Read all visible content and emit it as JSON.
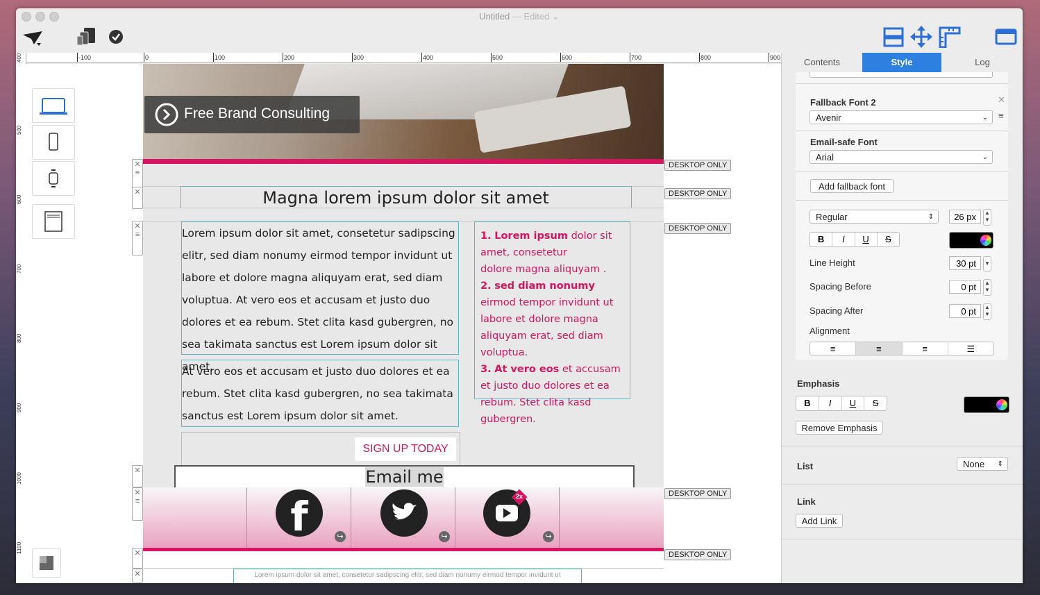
{
  "window": {
    "title": "Untitled",
    "edited": "— Edited"
  },
  "toolbar": {
    "left_icons": [
      "paper-plane-icon",
      "devices-icon",
      "checkmark-icon"
    ],
    "right_icons": [
      "layout-icon",
      "move-icon",
      "ruler-icon",
      "sidebar-icon"
    ]
  },
  "ruler": {
    "h_labels": [
      "-100",
      "0",
      "100",
      "200",
      "300",
      "400",
      "500",
      "600",
      "700",
      "800",
      "900"
    ],
    "v_labels": [
      "400",
      "500",
      "600",
      "700",
      "800",
      "900",
      "1000",
      "1100"
    ]
  },
  "devices": [
    "laptop-icon",
    "phone-icon",
    "watch-icon",
    "browser-icon"
  ],
  "canvas": {
    "hero_button": "Free Brand Consulting",
    "headline": "Magna lorem ipsum dolor sit amet",
    "para1": "Lorem ipsum dolor sit amet, consetetur sadipscing elitr, sed diam nonumy eirmod tempor invidunt ut labore et dolore magna aliquyam erat, sed diam voluptua. At vero eos et accusam et justo duo dolores et ea rebum. Stet clita kasd gubergren, no sea takimata sanctus est Lorem ipsum dolor sit amet.",
    "para2": "At vero eos et accusam et justo duo dolores et ea rebum. Stet clita kasd gubergren, no sea takimata sanctus est Lorem ipsum dolor sit amet.",
    "list": [
      {
        "num": "1.",
        "bold": "Lorem ipsum",
        "rest": " dolor sit amet, consetetur",
        "line2": "dolore magna aliquyam ."
      },
      {
        "num": "2.",
        "bold": "sed diam nonumy",
        "rest": " eirmod tempor invidunt ut labore et dolore magna aliquyam erat, sed diam voluptua.",
        "line2": ""
      },
      {
        "num": "3.",
        "bold": "At vero eos",
        "rest": " et accusam et justo duo dolores et ea rebum. Stet clita kasd gubergren.",
        "line2": ""
      }
    ],
    "signup": "SIGN UP TODAY",
    "email": "Email me",
    "footer": "Lorem ipsum dolor sit amet, consetetur sadipscing elitr, sed diam nonumy eirmod tempor invidunt ut",
    "desktop_only": "DESKTOP ONLY",
    "close_glyph": "✕",
    "handle_glyph": "≡",
    "social": [
      {
        "name": "facebook",
        "glyph": "f"
      },
      {
        "name": "twitter",
        "glyph": "🐦"
      },
      {
        "name": "youtube",
        "glyph": "▶",
        "badge": "2x"
      }
    ]
  },
  "panel": {
    "tabs": [
      "Contents",
      "Style",
      "Log"
    ],
    "active_tab": "Style",
    "fallback_font_2": {
      "label": "Fallback Font 2",
      "value": "Avenir"
    },
    "email_safe_font": {
      "label": "Email-safe Font",
      "value": "Arial"
    },
    "add_fallback": "Add fallback font",
    "weight": "Regular",
    "size": "26 px",
    "format_buttons": [
      "B",
      "I",
      "U",
      "S"
    ],
    "line_height": {
      "label": "Line Height",
      "value": "30 pt"
    },
    "spacing_before": {
      "label": "Spacing Before",
      "value": "0 pt"
    },
    "spacing_after": {
      "label": "Spacing After",
      "value": "0 pt"
    },
    "alignment": {
      "label": "Alignment",
      "options": [
        "left",
        "center",
        "right",
        "justify"
      ],
      "selected": "center"
    },
    "emphasis": {
      "title": "Emphasis",
      "remove": "Remove Emphasis"
    },
    "list": {
      "title": "List",
      "value": "None"
    },
    "link": {
      "title": "Link",
      "add": "Add Link"
    },
    "colors": {
      "text": "#000000",
      "accent": "#2d6fd8",
      "brand": "#d6145f"
    }
  }
}
